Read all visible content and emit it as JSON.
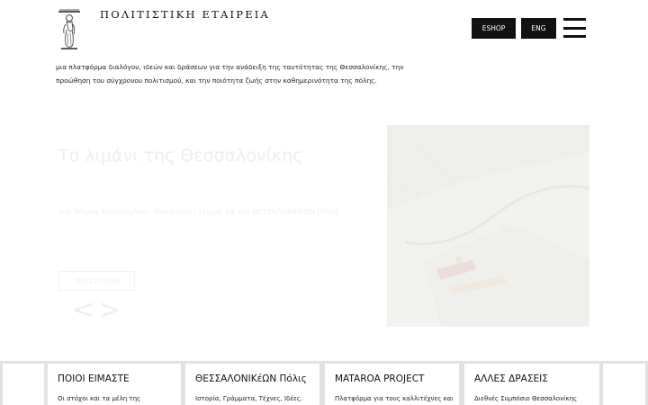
{
  "header": {
    "brand": "ΠΟΛΙΤΙΣΤΙΚΗ ΕΤΑΙΡΕΙΑ",
    "eshop_label": "ESHOP",
    "eng_label": "ENG"
  },
  "intro": {
    "line1": "μια πλατφόρμα διαλόγου, ιδεών και δράσεων για την ανάδειξη της ταυτότητας της Θεσσαλονίκης, την",
    "line2": "προώθηση του σύγχρονου πολιτισμού, και την ποιότητα ζωής στην καθημερινότητα της πόλης."
  },
  "slide": {
    "title": "Το λιμάνι της Θεσσαλονίκης",
    "caption": "της Βίλμας Χαστάογλου - Μαρτινίδη | τεύχος 69 του ΘΕΣΣΑΛΟΝΙΚΕΩΝ ΠΟΛΙΣ",
    "more_label": "ΠΕΡΙΣΣΟΤΕΡΑ",
    "prev_arrow": "<",
    "next_arrow": ">"
  },
  "cards": [
    {
      "title": "ΠΟΙΟΙ ΕΙΜΑΣΤΕ",
      "text": "Οι στόχοι και τα μέλη της"
    },
    {
      "title": "ΘΕΣΣΑΛΟΝΙΚέΩΝ Πόλις",
      "text": "Ιστορία, Γράμματα, Τέχνες, Ιδέες."
    },
    {
      "title": "MATAROA PROJECT",
      "text": "Πλατφόρμα για τους καλλιτέχνες και"
    },
    {
      "title": "ΑΛΛΕΣ ΔΡΑΣΕΙΣ",
      "text": "Διεθνές Συμπόσιο Θεσσαλονίκης"
    }
  ],
  "colors": {
    "button_bg": "#111111",
    "strip_bg": "#e2e2e2"
  }
}
